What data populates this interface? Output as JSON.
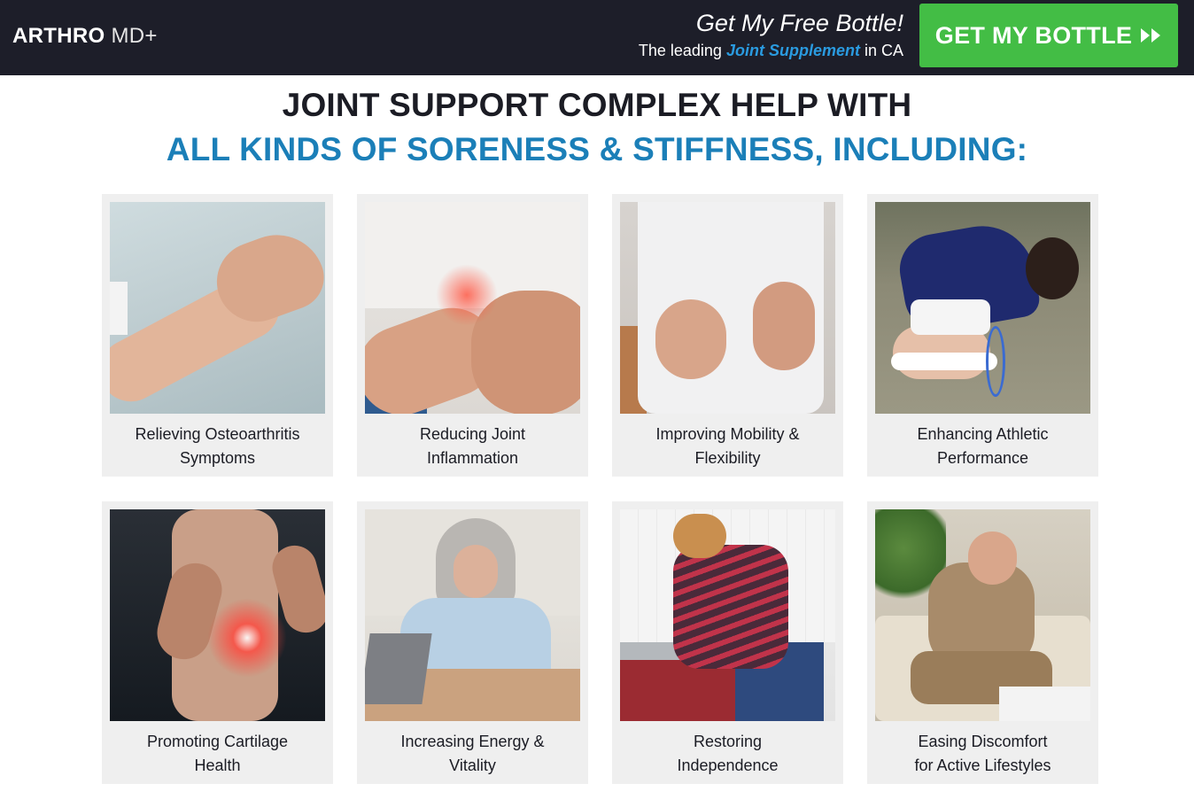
{
  "header": {
    "logo_strong": "ARTHRO",
    "logo_light": "MD+",
    "promo_title": "Get My Free Bottle!",
    "promo_sub_before": "The leading ",
    "promo_sub_highlight": "Joint Supplement",
    "promo_sub_after": " in CA",
    "cta_label": "GET MY BOTTLE"
  },
  "headline": {
    "line1": "JOINT SUPPORT COMPLEX HELP WITH",
    "line2": "ALL KINDS OF SORENESS & STIFFNESS, INCLUDING:"
  },
  "benefits": [
    {
      "line1": "Relieving Osteoarthritis",
      "line2": "Symptoms"
    },
    {
      "line1": "Reducing Joint",
      "line2": "Inflammation"
    },
    {
      "line1": "Improving Mobility &",
      "line2": "Flexibility"
    },
    {
      "line1": "Enhancing Athletic",
      "line2": "Performance"
    },
    {
      "line1": "Promoting Cartilage",
      "line2": "Health"
    },
    {
      "line1": "Increasing Energy &",
      "line2": "Vitality"
    },
    {
      "line1": "Restoring",
      "line2": "Independence"
    },
    {
      "line1": "Easing Discomfort",
      "line2": "for Active Lifestyles"
    }
  ],
  "colors": {
    "header_bg": "#1d1e29",
    "cta_green": "#43bd45",
    "accent_blue": "#1b7fb8",
    "highlight_blue": "#2a9be0",
    "card_bg": "#efefef"
  },
  "icons": {
    "cta_arrows": "double-chevron-right-icon"
  }
}
